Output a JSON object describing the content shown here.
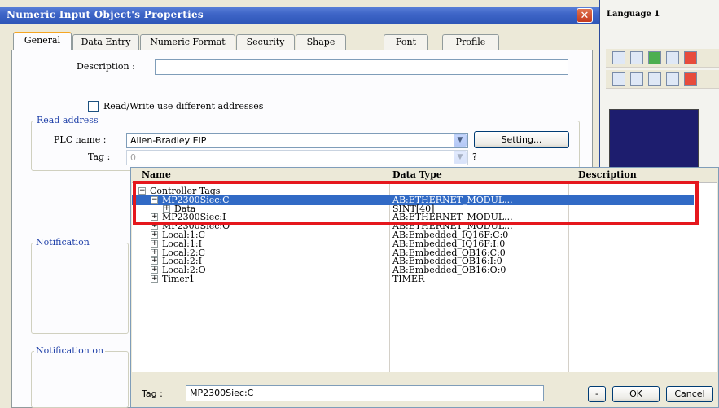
{
  "window": {
    "title": "Numeric Input Object's Properties",
    "close_glyph": "✕"
  },
  "background_app": {
    "label": "Language 1"
  },
  "tabs": [
    "General",
    "Data Entry",
    "Numeric Format",
    "Security",
    "Shape",
    "Font",
    "Profile"
  ],
  "general": {
    "description_label": "Description :",
    "description_value": "",
    "rw_checkbox_label": "Read/Write use different addresses",
    "rw_checked": false,
    "read_address_title": "Read address",
    "plc_name_label": "PLC name :",
    "plc_name_value": "Allen-Bradley EIP",
    "setting_button": "Setting...",
    "tag_label": "Tag :",
    "tag_value": "0",
    "notification_title": "Notification",
    "notification_on_title": "Notification on"
  },
  "tag_browser": {
    "columns": [
      "Name",
      "Data Type",
      "Description"
    ],
    "rows": [
      {
        "name": "Controller Tags",
        "type": "",
        "level": 0,
        "expander": "−",
        "selected": false
      },
      {
        "name": "MP2300Siec:C",
        "type": "AB:ETHERNET_MODUL...",
        "level": 1,
        "expander": "−",
        "selected": true
      },
      {
        "name": "Data",
        "type": "SINT[40]",
        "level": 2,
        "expander": "+",
        "selected": false
      },
      {
        "name": "MP2300Siec:I",
        "type": "AB:ETHERNET_MODUL...",
        "level": 1,
        "expander": "+",
        "selected": false
      },
      {
        "name": "MP2300Siec:O",
        "type": "AB:ETHERNET_MODUL...",
        "level": 1,
        "expander": "+",
        "selected": false
      },
      {
        "name": "Local:1:C",
        "type": "AB:Embedded_IQ16F:C:0",
        "level": 1,
        "expander": "+",
        "selected": false
      },
      {
        "name": "Local:1:I",
        "type": "AB:Embedded_IQ16F:I:0",
        "level": 1,
        "expander": "+",
        "selected": false
      },
      {
        "name": "Local:2:C",
        "type": "AB:Embedded_OB16:C:0",
        "level": 1,
        "expander": "+",
        "selected": false
      },
      {
        "name": "Local:2:I",
        "type": "AB:Embedded_OB16:I:0",
        "level": 1,
        "expander": "+",
        "selected": false
      },
      {
        "name": "Local:2:O",
        "type": "AB:Embedded_OB16:O:0",
        "level": 1,
        "expander": "+",
        "selected": false
      },
      {
        "name": "Timer1",
        "type": "TIMER",
        "level": 1,
        "expander": "+",
        "selected": false
      }
    ],
    "tag_label": "Tag :",
    "tag_value": "MP2300Siec:C",
    "minus_button": "-",
    "ok_button": "OK",
    "cancel_button": "Cancel"
  },
  "colors": {
    "title_bar": "#3f66c8",
    "selection": "#316ac5",
    "highlight": "#e5171d",
    "group_title": "#1e3fa8"
  }
}
